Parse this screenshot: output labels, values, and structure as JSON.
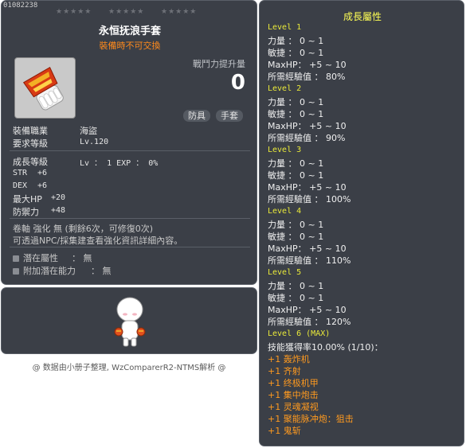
{
  "item": {
    "id": "01082238",
    "stars": "★★★★★",
    "name": "永恒抚浪手套",
    "subtitle": "裝備時不可交換",
    "power_label": "戰鬥力提升量",
    "power_value": "0",
    "tags": [
      "防具",
      "手套"
    ],
    "job_label": "裝備職業",
    "job_value": "海盜",
    "req_label": "要求等級",
    "req_value": "Lv.120",
    "growth_label": "成長等級",
    "growth_value": "Lv ： 1   EXP ： 0%",
    "stats": [
      {
        "name": "STR",
        "value": "+6"
      },
      {
        "name": "DEX",
        "value": "+6"
      },
      {
        "name": "最大HP",
        "value": "+20"
      },
      {
        "name": "防禦力",
        "value": "+48"
      }
    ],
    "scroll_line": "卷軸 強化 無 (剩餘6次，可修復0次)",
    "info_line": "可透過NPC/採集建查看強化資訊詳細內容。",
    "potential_label": "潛在屬性",
    "potential_value": "： 無",
    "bonus_label": "附加潛在能力",
    "bonus_value": "： 無"
  },
  "credit": "@ 数据由小册子整理, WzComparerR2-NTMS解析 @",
  "growth": {
    "title": "成長屬性",
    "levels": [
      {
        "label": "Level 1",
        "lines": [
          "力量 ： 0 ~ 1",
          "敏捷 ： 0 ~ 1",
          "MaxHP： +5 ~ 10",
          "所需經驗值 ： 80%"
        ]
      },
      {
        "label": "Level 2",
        "lines": [
          "力量 ： 0 ~ 1",
          "敏捷 ： 0 ~ 1",
          "MaxHP： +5 ~ 10",
          "所需經驗值 ： 90%"
        ]
      },
      {
        "label": "Level 3",
        "lines": [
          "力量 ： 0 ~ 1",
          "敏捷 ： 0 ~ 1",
          "MaxHP： +5 ~ 10",
          "所需經驗值 ： 100%"
        ]
      },
      {
        "label": "Level 4",
        "lines": [
          "力量 ： 0 ~ 1",
          "敏捷 ： 0 ~ 1",
          "MaxHP： +5 ~ 10",
          "所需經驗值 ： 110%"
        ]
      },
      {
        "label": "Level 5",
        "lines": [
          "力量 ： 0 ~ 1",
          "敏捷 ： 0 ~ 1",
          "MaxHP： +5 ~ 10",
          "所需經驗值 ： 120%"
        ]
      }
    ],
    "max_label": "Level 6 (MAX)",
    "max_line": "技能獲得率10.00% (1/10)：",
    "skills": [
      "+1 轰炸机",
      "+1 齐射",
      "+1 终极机甲",
      "+1 集中炮击",
      "+1 灵魂凝视",
      "+1 聚能脉冲炮：狙击",
      "+1 鬼斩"
    ]
  }
}
